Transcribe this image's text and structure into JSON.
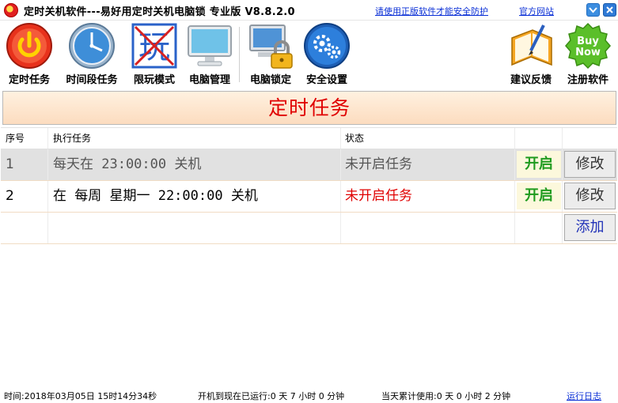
{
  "window": {
    "title": "定时关机软件---易好用定时关机电脑锁  专业版  V8.8.2.0",
    "link_genuine": "请使用正版软件才能安全防护",
    "link_site": "官方网站"
  },
  "toolbar": {
    "items": [
      {
        "label": "定时任务",
        "icon": "power-icon"
      },
      {
        "label": "时间段任务",
        "icon": "clock-icon"
      },
      {
        "label": "限玩模式",
        "icon": "no-play-icon",
        "glyph": "玩"
      },
      {
        "label": "电脑管理",
        "icon": "monitor-icon"
      },
      {
        "label": "电脑锁定",
        "icon": "computer-lock-icon"
      },
      {
        "label": "安全设置",
        "icon": "gears-icon"
      },
      {
        "label": "建议反馈",
        "icon": "notebook-pen-icon"
      },
      {
        "label": "注册软件",
        "icon": "buy-now-icon",
        "badge_line1": "Buy",
        "badge_line2": "Now"
      }
    ]
  },
  "banner": {
    "title": "定时任务"
  },
  "table": {
    "headers": {
      "no": "序号",
      "task": "执行任务",
      "status": "状态"
    },
    "rows": [
      {
        "no": "1",
        "task": "每天在 23:00:00 关机",
        "status": "未开启任务",
        "enable": "开启",
        "edit": "修改"
      },
      {
        "no": "2",
        "task": "在 每周 星期一 22:00:00 关机",
        "status": "未开启任务",
        "enable": "开启",
        "edit": "修改"
      }
    ],
    "add_label": "添加"
  },
  "status_bar": {
    "time": "时间:2018年03月05日 15时14分34秒",
    "running": "开机到现在已运行:0 天 7 小时 0 分钟",
    "usage": "当天累计使用:0 天 0 小时 2 分钟",
    "log_link": "运行日志"
  },
  "colors": {
    "accent_red": "#e00000",
    "link_blue": "#0a2fd6",
    "enable_green": "#1f9b1f",
    "banner_bg": "#fcdcbf"
  }
}
